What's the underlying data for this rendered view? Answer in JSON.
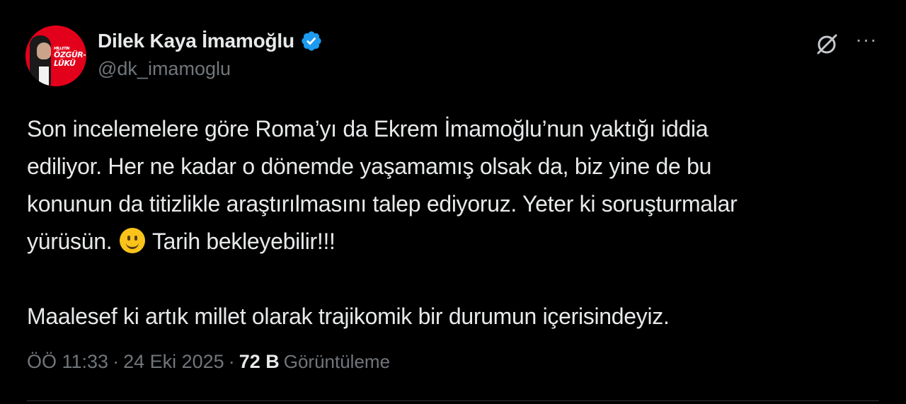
{
  "author": {
    "display_name": "Dilek Kaya İmamoğlu",
    "handle": "@dk_imamoglu",
    "verified_icon": "verified-badge-icon",
    "verified_color": "#1d9bf0",
    "avatar_text_small": "MİLLETİN",
    "avatar_text": "ÖZGÜR-LÜKÜ"
  },
  "tweet": {
    "paragraph1_a": "Son incelemelere göre Roma’yı da Ekrem İmamoğlu’nun yaktığı iddia\nediliyor. Her ne kadar o dönemde yaşamamış olsak da, biz yine de bu\nkonunun da titizlikle araştırılmasını talep ediyoruz. Yeter ki soruşturmalar\nyürüsün. ",
    "paragraph1_b": " Tarih bekleyebilir!!!",
    "paragraph2": "Maalesef ki artık millet olarak trajikomik bir durumun içerisindeyiz."
  },
  "meta": {
    "time": "ÖÖ 11:33",
    "date": "24 Eki 2025",
    "separator": "·",
    "views_count": "72 B",
    "views_label": "Görüntüleme"
  },
  "icons": {
    "grok": "grok-icon",
    "more": "more-options-icon"
  }
}
